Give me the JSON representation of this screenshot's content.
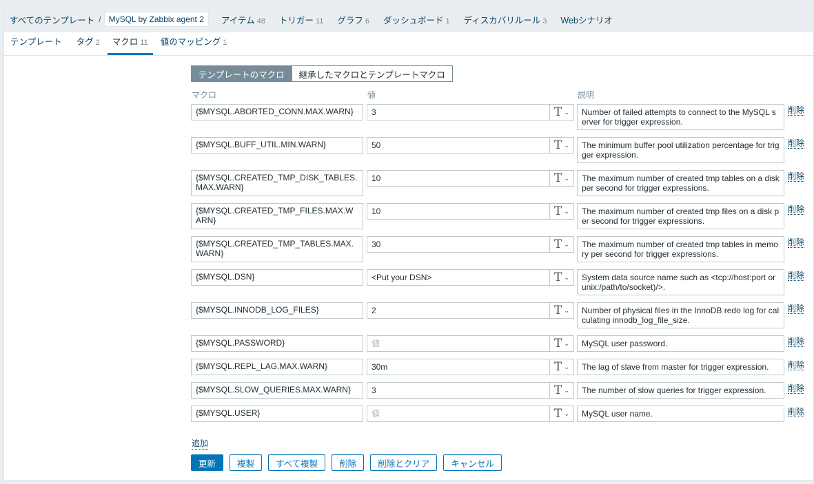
{
  "breadcrumbs": {
    "root": "すべてのテンプレート",
    "sep": "/",
    "current": "MySQL by Zabbix agent 2",
    "tabs": [
      {
        "label": "アイテム",
        "count": "48"
      },
      {
        "label": "トリガー",
        "count": "11"
      },
      {
        "label": "グラフ",
        "count": "6"
      },
      {
        "label": "ダッシュボード",
        "count": "1"
      },
      {
        "label": "ディスカバリルール",
        "count": "3"
      },
      {
        "label": "Webシナリオ",
        "count": ""
      }
    ]
  },
  "subtabs": [
    {
      "label": "テンプレート",
      "count": ""
    },
    {
      "label": "タグ",
      "count": "2"
    },
    {
      "label": "マクロ",
      "count": "11"
    },
    {
      "label": "値のマッピング",
      "count": "1"
    }
  ],
  "macro_mode": {
    "template_macros": "テンプレートのマクロ",
    "inherited_macros": "継承したマクロとテンプレートマクロ"
  },
  "columns": {
    "macro": "マクロ",
    "value": "値",
    "description": "説明"
  },
  "macros": [
    {
      "macro": "{$MYSQL.ABORTED_CONN.MAX.WARN}",
      "value": "3",
      "description": "Number of failed attempts to connect to the MySQL server for trigger expression."
    },
    {
      "macro": "{$MYSQL.BUFF_UTIL.MIN.WARN}",
      "value": "50",
      "description": "The minimum buffer pool utilization percentage for trigger expression."
    },
    {
      "macro": "{$MYSQL.CREATED_TMP_DISK_TABLES.MAX.WARN}",
      "value": "10",
      "description": "The maximum number of created tmp tables on a disk per second for trigger expressions."
    },
    {
      "macro": "{$MYSQL.CREATED_TMP_FILES.MAX.WARN}",
      "value": "10",
      "description": "The maximum number of created tmp files on a disk per second for trigger expressions."
    },
    {
      "macro": "{$MYSQL.CREATED_TMP_TABLES.MAX.WARN}",
      "value": "30",
      "description": "The maximum number of created tmp tables in memory per second for trigger expressions."
    },
    {
      "macro": "{$MYSQL.DSN}",
      "value": "<Put your DSN>",
      "description": "System data source name such as <tcp://host:port or unix:/path/to/socket)/>."
    },
    {
      "macro": "{$MYSQL.INNODB_LOG_FILES}",
      "value": "2",
      "description": "Number of physical files in the InnoDB redo log for calculating innodb_log_file_size."
    },
    {
      "macro": "{$MYSQL.PASSWORD}",
      "value": "",
      "description": "MySQL user password."
    },
    {
      "macro": "{$MYSQL.REPL_LAG.MAX.WARN}",
      "value": "30m",
      "description": "The lag of slave from master for trigger expression."
    },
    {
      "macro": "{$MYSQL.SLOW_QUERIES.MAX.WARN}",
      "value": "3",
      "description": "The number of slow queries for trigger expression."
    },
    {
      "macro": "{$MYSQL.USER}",
      "value": "",
      "description": "MySQL user name."
    }
  ],
  "value_placeholder": "値",
  "type_glyph": "T",
  "type_chevron": "⌄",
  "remove_label": "削除",
  "add_label": "追加",
  "buttons": {
    "update": "更新",
    "clone": "複製",
    "full_clone": "すべて複製",
    "delete": "削除",
    "delete_and_clear": "削除とクリア",
    "cancel": "キャンセル"
  },
  "colors": {
    "accent": "#0275b8",
    "link": "#0a466a",
    "muted": "#768d99"
  }
}
